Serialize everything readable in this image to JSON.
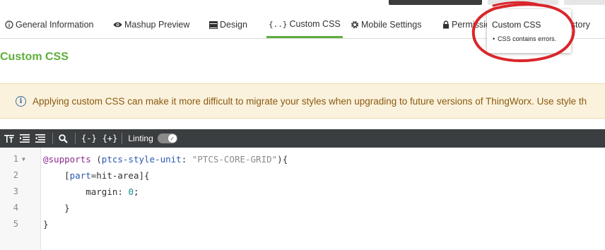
{
  "tabs": [
    {
      "label": "General Information",
      "icon": "info-circle-icon"
    },
    {
      "label": "Mashup Preview",
      "icon": "eye-icon"
    },
    {
      "label": "Design",
      "icon": "design-icon"
    },
    {
      "label": "Custom CSS",
      "icon": "braces-icon",
      "active": true
    },
    {
      "label": "Mobile Settings",
      "icon": "gear-icon"
    },
    {
      "label": "Permissio",
      "icon": "lock-icon"
    },
    {
      "label": "istory",
      "icon": ""
    }
  ],
  "page_title": "Custom CSS",
  "banner": {
    "message": "Applying custom CSS can make it more difficult to migrate your styles when upgrading to future versions of ThingWorx. Use style th",
    "icon": "info-icon"
  },
  "toolbar": {
    "linting_label": "Linting",
    "linting_enabled": true,
    "buttons": [
      "format-icon",
      "align-left-icon",
      "align-right-icon",
      "search-icon",
      "collapse-braces-icon",
      "expand-braces-icon"
    ]
  },
  "code": {
    "lines": [
      "1",
      "2",
      "3",
      "4",
      "5"
    ],
    "l1_kw": "@supports",
    "l1_open": " (",
    "l1_prop": "ptcs-style-unit",
    "l1_colon": ": ",
    "l1_str": "\"PTCS-CORE-GRID\"",
    "l1_close": "){",
    "l2_indent": "    [",
    "l2_attr": "part",
    "l2_rest": "=hit-area]{",
    "l3_indent": "        ",
    "l3_prop": "margin",
    "l3_colon": ": ",
    "l3_num": "0",
    "l3_semi": ";",
    "l4": "    }",
    "l5": "}"
  },
  "tooltip": {
    "title": "Custom CSS",
    "item": "CSS contains errors."
  },
  "colors": {
    "accent_green": "#5fae3c",
    "toolbar_bg": "#3b3e40",
    "banner_bg": "#fbf2dd",
    "annotation_red": "#d9262b"
  }
}
